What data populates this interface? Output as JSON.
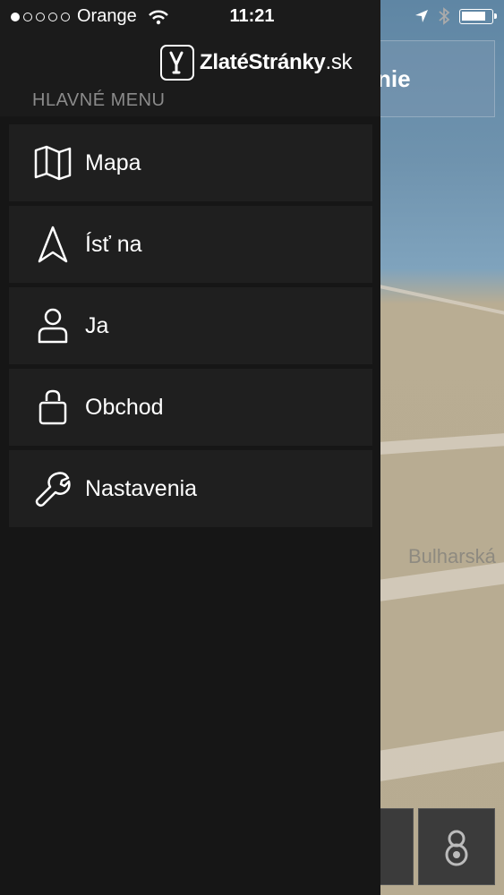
{
  "status_bar": {
    "carrier": "Orange",
    "time": "11:21",
    "signal_dots_filled": 1,
    "signal_dots_total": 5
  },
  "map": {
    "search_text_partial": "nie",
    "street_label": "Bulharská"
  },
  "drawer": {
    "logo": {
      "main": "ZlatéStránky",
      "suffix": ".sk"
    },
    "section_title": "HLAVNÉ MENU",
    "items": [
      {
        "label": "Mapa",
        "icon": "map-icon"
      },
      {
        "label": "Ísť na",
        "icon": "navigation-arrow-icon"
      },
      {
        "label": "Ja",
        "icon": "person-icon"
      },
      {
        "label": "Obchod",
        "icon": "shopping-bag-icon"
      },
      {
        "label": "Nastavenia",
        "icon": "wrench-icon"
      }
    ]
  },
  "colors": {
    "drawer_background": "#161616",
    "menu_item_background": "#1f1f1f",
    "section_title": "#8b8b8b",
    "text": "#ffffff"
  }
}
